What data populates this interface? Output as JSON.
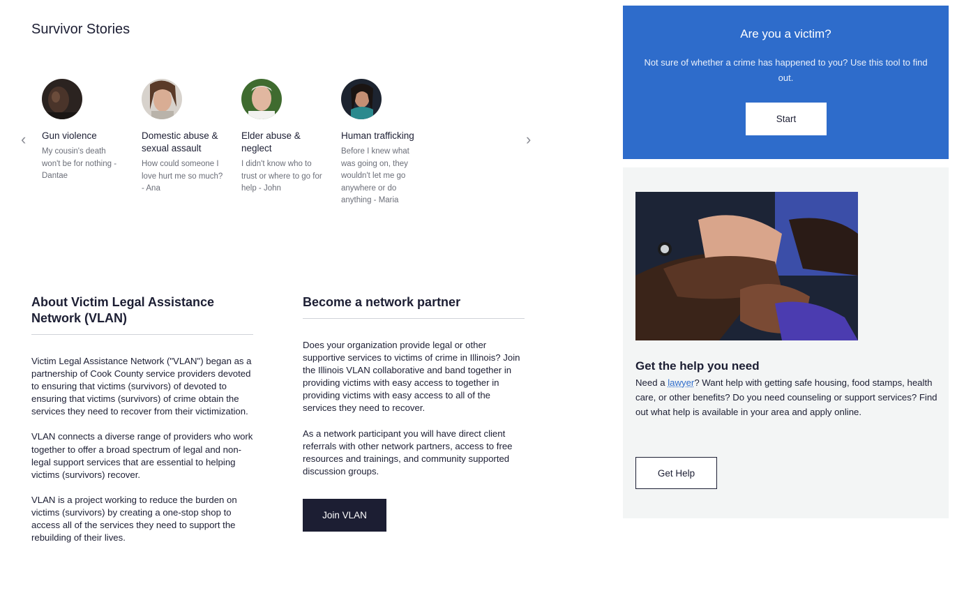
{
  "stories": {
    "title": "Survivor Stories",
    "prev_arrow": "‹",
    "next_arrow": "›",
    "items": [
      {
        "title": "Gun violence",
        "quote": "My cousin's death won't be for nothing - Dantae"
      },
      {
        "title": "Domestic abuse & sexual assault",
        "quote": "How could someone I love hurt me so much? - Ana"
      },
      {
        "title": "Elder abuse & neglect",
        "quote": "I didn't know who to trust or where to go for help - John"
      },
      {
        "title": "Human trafficking",
        "quote": "Before I knew what was going on, they wouldn't let me go anywhere or do anything - Maria"
      }
    ]
  },
  "about": {
    "title": "About Victim Legal Assistance Network (VLAN)",
    "paragraphs": [
      "Victim Legal Assistance Network (\"VLAN\") began as a partnership of Cook County service providers devoted to ensuring that victims (survivors) of devoted to ensuring that victims (survivors) of crime obtain the services they need to recover from their victimization.",
      "VLAN connects a diverse range of providers who work together to offer a broad spectrum of legal and non-legal support services that are essential to helping victims (survivors) recover.",
      "VLAN is a project working to reduce the burden on victims (survivors) by creating a one-stop shop to access all of the services they need to support the rebuilding of their lives."
    ]
  },
  "partner": {
    "title": "Become a network partner",
    "paragraphs": [
      "Does your organization provide legal or other supportive services to victims of crime in Illinois? Join the Illinois VLAN collaborative and band together in providing victims with easy access to together in providing victims with easy access to all of the services they need to recover.",
      "As a network participant you will have direct client referrals with other network partners, access to free resources and trainings, and community supported discussion groups."
    ],
    "button": "Join VLAN"
  },
  "victim_card": {
    "title": "Are you a victim?",
    "text": "Not sure of whether a crime has happened to you? Use this tool to find out.",
    "button": "Start",
    "bg_color": "#2e6ccb"
  },
  "help_card": {
    "title": "Get the help you need",
    "text_before_link": "Need a ",
    "link": "lawyer",
    "text_after_link": "? Want help with getting safe housing, food stamps, health care, or other benefits? Do you need counseling or support services? Find out what help is available in your area and apply online.",
    "button": "Get Help"
  }
}
